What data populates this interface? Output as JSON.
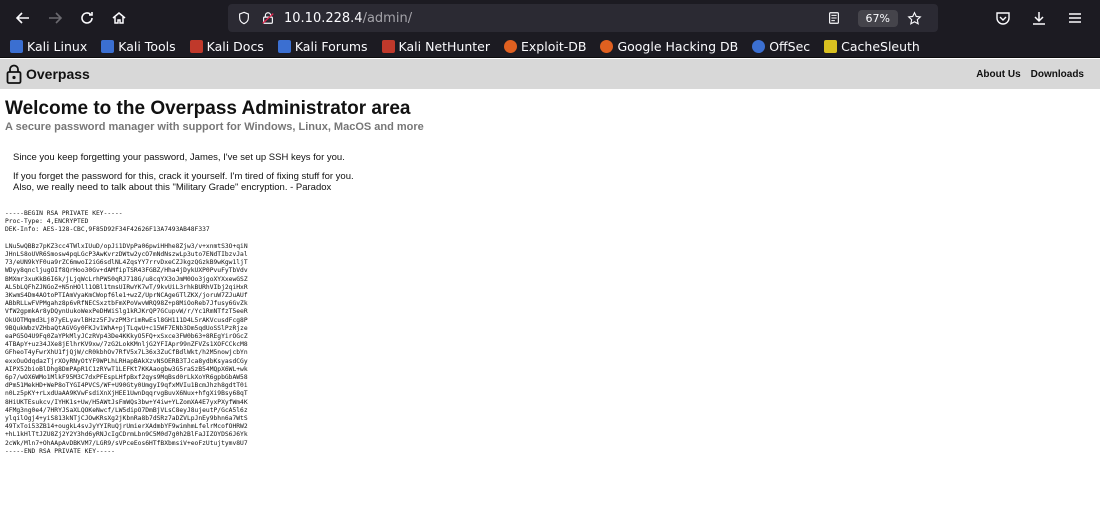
{
  "browser": {
    "url_host": "10.10.228.4",
    "url_path": "/admin/",
    "zoom": "67%",
    "bookmarks": [
      {
        "label": "Kali Linux",
        "color": "#3b6fd1"
      },
      {
        "label": "Kali Tools",
        "color": "#3b6fd1"
      },
      {
        "label": "Kali Docs",
        "color": "#c0392b"
      },
      {
        "label": "Kali Forums",
        "color": "#3b6fd1"
      },
      {
        "label": "Kali NetHunter",
        "color": "#c0392b"
      },
      {
        "label": "Exploit-DB",
        "color": "#e06020"
      },
      {
        "label": "Google Hacking DB",
        "color": "#e06020"
      },
      {
        "label": "OffSec",
        "color": "#3b6fd1"
      },
      {
        "label": "CacheSleuth",
        "color": "#d9c020"
      }
    ]
  },
  "site": {
    "logo_text": "Overpass",
    "nav": {
      "about": "About Us",
      "downloads": "Downloads"
    },
    "title": "Welcome to the Overpass Administrator area",
    "subtitle": "A secure password manager with support for Windows, Linux, MacOS and more",
    "message_line1": "Since you keep forgetting your password, James, I've set up SSH keys for you.",
    "message_line2": "If you forget the password for this, crack it yourself. I'm tired of fixing stuff for you.",
    "message_line3": "Also, we really need to talk about this \"Military Grade\" encryption. - Paradox",
    "key_header": [
      "-----BEGIN RSA PRIVATE KEY-----",
      "Proc-Type: 4,ENCRYPTED",
      "DEK-Info: AES-128-CBC,9F85D92F34F42626F13A7493AB48F337"
    ],
    "key_body": [
      "LNu5wQBBz7pKZ3cc4TWlxIUuD/opJi1DVpPa06pwiHHhe8Zjw3/v+xnmtS3O+qiN",
      "JHnLS8oUVR6Smosw4pqLGcP3AwKvrzDWtw2ycO7mNdNszwLp3uto7ENdTIbzvJal",
      "73/eUN9kYF0ua9rZC6mwoI2iG6sdlNL4ZqsYY7rrvDxeCZJkgzQGzkB9wKgw1ljT",
      "WDyy8qncljugOIf8QrHoo30Gv+dAMfipTSR43FGBZ/Hha4jDykUXP0PvuFyTbVdv",
      "BMXmr3xuKkB6I6k/jLjqWcLrhPWS0qRJ718G/u8cqYX3oJmM0Oo3jgoXYXxewGSZ",
      "AL5bLQFhZJNGoZ+N5nHOll1OBl1tmsUIRwYK7wT/9kvUiL3rhkBURhVIbj2qiHxR",
      "3KwmS4Dm4AOtoPTIAmVyaKmCWopf6le1+wzZ/UprNCAgeGTlZKX/joruW7ZJuAUf",
      "ABbRLLwFVPMgahz8p6vRfNECSxztbFmXPoVwvWRQ98Z+p8MiOoReb7Jfusy6GvZk",
      "VfW2gpmkAr8yDQynUukoWexPeDHWiSlg1kRJKrQP7GCupvW/r/Yc1RmNTfzT5eeR",
      "OkUOTMqmd3Lj07yELyavlBHzz5FJvzPM3rimRwEsl8GH111D4L5rAKVcusdFcg8P",
      "9BQukWbzVZHbaQtAGVGy0FKJv1WhA+pjTLqwU+c15WF7ENb3Dm5qdUoSSlPzRjze",
      "eaPG5O4U9Fq0ZaYPkMlyJCzRVp43De4KKkyO5FQ+xSxce3FW0b63+8REgYirOGcZ",
      "4TBApY+uz34JXe8jElhrKV9xw/7zG2LokKMnljG2YFIApr99nZFVZs1XOFCCkcM8",
      "GFheoT4yFwrXhU1fjQjW/cR0kbhOv7RfV5x7L36x3ZuCfBdlWkt/h2M5nowjcbYn",
      "exxOuOdqdazTjrXOyRNyOtYF9WPLhLRHapBAkXzvNSOERB3TJca8ydbKsyasdCGy",
      "AIPX52bioBlDhg8DmPApR1C1zRYwT1LEFKt7KKAaogbw3G5raSzB54MQpX6WL+wk",
      "6p7/wOX6WMo1MlkF95M3C7dxPFEspLHfpBxf2qys9MqBsd0rLkXoYR6gpbGbAW58",
      "dPm51MekHD+WeP8oTYGI4PVCS/WF+U90Gty0UmgyI9qfxMVIu1BcmJhzh8gdtT0i",
      "n0Lz5pKY+rLxdUaAA9KVwFsdiXnXjHEE1UwnDqqrvgBuvX6Nux+hfgXi9Bsy68qT",
      "8HiUKTEsukcv/IYHK1s+Uw/H5AWtJsFmWQs3bw+Y4iw+YLZomXA4E7yxPXyfWm4K",
      "4FMg3ng0e4/7HRYJSaXLQOKeNwcf/LW5dipO7DmBjVLsC8eyJ8ujeutP/GcA5l6z",
      "ylqilOgj4+yiS813kNTjCJOwKRsXg2jKbnRa8b7dSRz7aDZVLpJnEy9bhn6a7WtS",
      "49TxToi53ZB14+ougkL4svJyYYIRuQjrUmierXAdmbYF9wimhmLfelrMcofOHRW2",
      "+hL1kHlTtJZU8Zj2Y2Y3hd6yRNJcIgCDrmLbn9C5M0d7g0h2BlFaJIZOYDS6J6Yk",
      "2cWk/Mln7+OhAApAvDBKVM7/LGR9/sVPceEos6HTfBXbmsiV+eoFzUtujtymv8U7"
    ],
    "key_footer": "-----END RSA PRIVATE KEY-----"
  }
}
